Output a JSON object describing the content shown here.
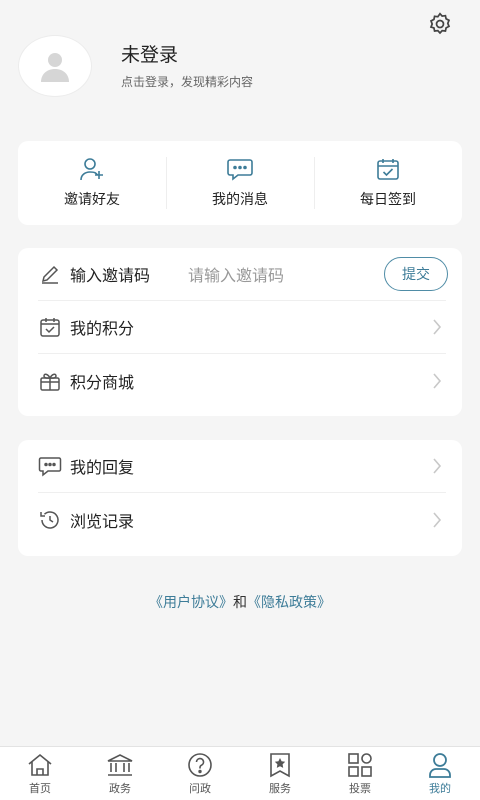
{
  "header": {
    "title": "未登录",
    "subtitle": "点击登录，发现精彩内容"
  },
  "quick_actions": [
    {
      "label": "邀请好友",
      "icon": "add-user-icon"
    },
    {
      "label": "我的消息",
      "icon": "message-icon"
    },
    {
      "label": "每日签到",
      "icon": "calendar-check-icon"
    }
  ],
  "invite": {
    "label": "输入邀请码",
    "placeholder": "请输入邀请码",
    "submit_label": "提交"
  },
  "menu_group1": [
    {
      "label": "我的积分",
      "icon": "points-calendar-icon"
    },
    {
      "label": "积分商城",
      "icon": "gift-box-icon"
    }
  ],
  "menu_group2": [
    {
      "label": "我的回复",
      "icon": "reply-bubble-icon"
    },
    {
      "label": "浏览记录",
      "icon": "history-clock-icon"
    }
  ],
  "agreement": {
    "user_agreement": "《用户协议》",
    "and": "和",
    "privacy_policy": "《隐私政策》"
  },
  "tabs": [
    {
      "label": "首页",
      "icon": "home-icon"
    },
    {
      "label": "政务",
      "icon": "government-icon"
    },
    {
      "label": "问政",
      "icon": "question-icon"
    },
    {
      "label": "服务",
      "icon": "star-bookmark-icon"
    },
    {
      "label": "投票",
      "icon": "grid-icon"
    },
    {
      "label": "我的",
      "icon": "user-icon",
      "active": true
    }
  ],
  "colors": {
    "accent": "#3d7c98",
    "background": "#f5f5f5",
    "card": "#ffffff"
  }
}
